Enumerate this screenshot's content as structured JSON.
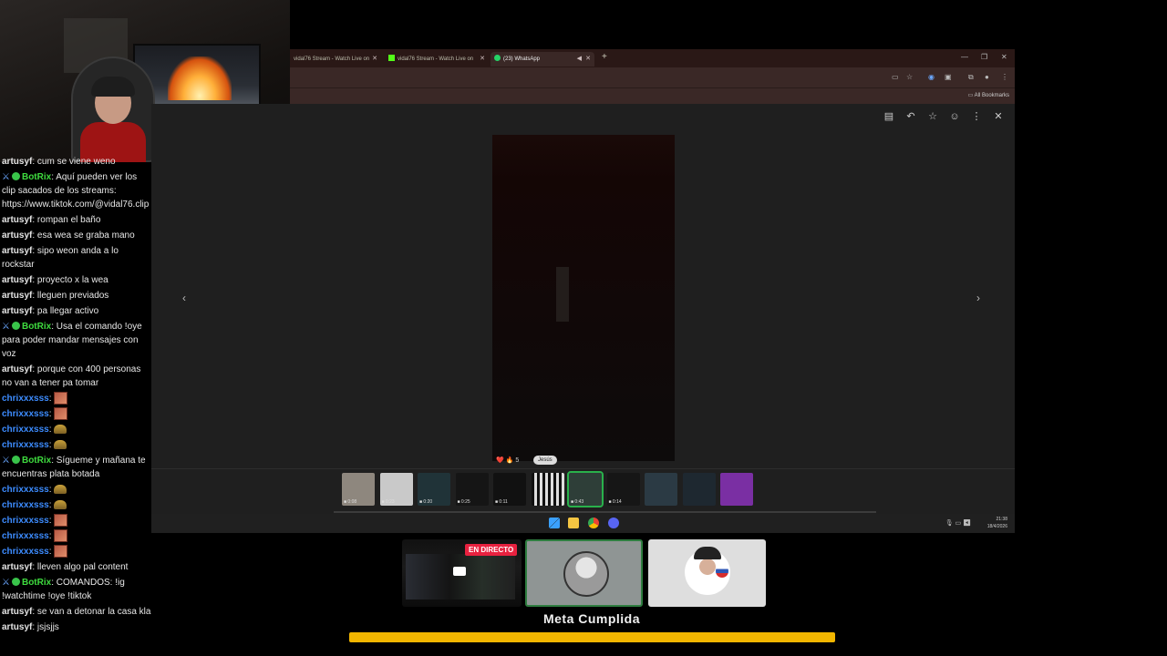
{
  "browser": {
    "tabs": [
      {
        "label": "vidal76 Stream - Watch Live on",
        "icon": "kick-icon"
      },
      {
        "label": "vidal76 Stream - Watch Live on",
        "icon": "kick-icon"
      },
      {
        "label": "(23) WhatsApp",
        "icon": "whatsapp-icon",
        "active": true
      }
    ],
    "bookmarks_label": "All Bookmarks"
  },
  "viewer": {
    "reactions": "❤️ 🔥 5",
    "tooltip": "Jesús",
    "thumbnails": [
      {
        "duration": "0:08",
        "color": "#8e877e"
      },
      {
        "duration": "0:23",
        "color": "#c9c9c9"
      },
      {
        "duration": "0:20",
        "color": "#203338"
      },
      {
        "duration": "0:25",
        "color": "#151515"
      },
      {
        "duration": "0:11",
        "color": "#111111"
      },
      {
        "duration": "",
        "color": "#eeeeee",
        "qr": true
      },
      {
        "duration": "0:43",
        "color": "#2e3e38",
        "selected": true
      },
      {
        "duration": "0:14",
        "color": "#161616"
      },
      {
        "duration": "",
        "color": "#2b3a44"
      },
      {
        "duration": "",
        "color": "#1e2830"
      },
      {
        "duration": "",
        "color": "#7a2fa3"
      }
    ]
  },
  "taskbar": {
    "time": "21:38",
    "date": "18/4/2026"
  },
  "chat": [
    {
      "user": "artusyf",
      "text": "cum se viene weno"
    },
    {
      "user": "BotRix",
      "bot": true,
      "text": "Aquí pueden ver los clip sacados de los streams: https://www.tiktok.com/@vidal76.clip"
    },
    {
      "user": "artusyf",
      "text": "rompan el baño"
    },
    {
      "user": "artusyf",
      "text": "esa wea se graba mano"
    },
    {
      "user": "artusyf",
      "text": "sipo weon anda a lo rockstar"
    },
    {
      "user": "artusyf",
      "text": "proyecto x la wea"
    },
    {
      "user": "artusyf",
      "text": "lleguen previados"
    },
    {
      "user": "artusyf",
      "text": "pa llegar activo"
    },
    {
      "user": "BotRix",
      "bot": true,
      "text": "Usa el comando !oye para poder mandar mensajes con voz"
    },
    {
      "user": "artusyf",
      "text": "porque con 400 personas no van a tener pa tomar"
    },
    {
      "user": "chrixxxsss",
      "blue": true,
      "emote": "big"
    },
    {
      "user": "chrixxxsss",
      "blue": true,
      "emote": "big"
    },
    {
      "user": "chrixxxsss",
      "blue": true,
      "emote": "small"
    },
    {
      "user": "chrixxxsss",
      "blue": true,
      "emote": "small"
    },
    {
      "user": "BotRix",
      "bot": true,
      "text": "Sígueme y mañana te encuentras plata botada"
    },
    {
      "user": "chrixxxsss",
      "blue": true,
      "emote": "small"
    },
    {
      "user": "chrixxxsss",
      "blue": true,
      "emote": "small"
    },
    {
      "user": "chrixxxsss",
      "blue": true,
      "emote": "big"
    },
    {
      "user": "chrixxxsss",
      "blue": true,
      "emote": "big"
    },
    {
      "user": "chrixxxsss",
      "blue": true,
      "emote": "big"
    },
    {
      "user": "artusyf",
      "text": "lleven algo pal content"
    },
    {
      "user": "BotRix",
      "bot": true,
      "text": "COMANDOS: !ig !watchtime !oye !tiktok"
    },
    {
      "user": "artusyf",
      "text": "se van a detonar la casa kla"
    },
    {
      "user": "artusyf",
      "text": "jsjsjjs"
    }
  ],
  "overlay": {
    "live_badge": "EN DIRECTO",
    "goal_label": "Meta Cumplida",
    "goal_progress": 1.0,
    "goal_color": "#f2b600"
  }
}
